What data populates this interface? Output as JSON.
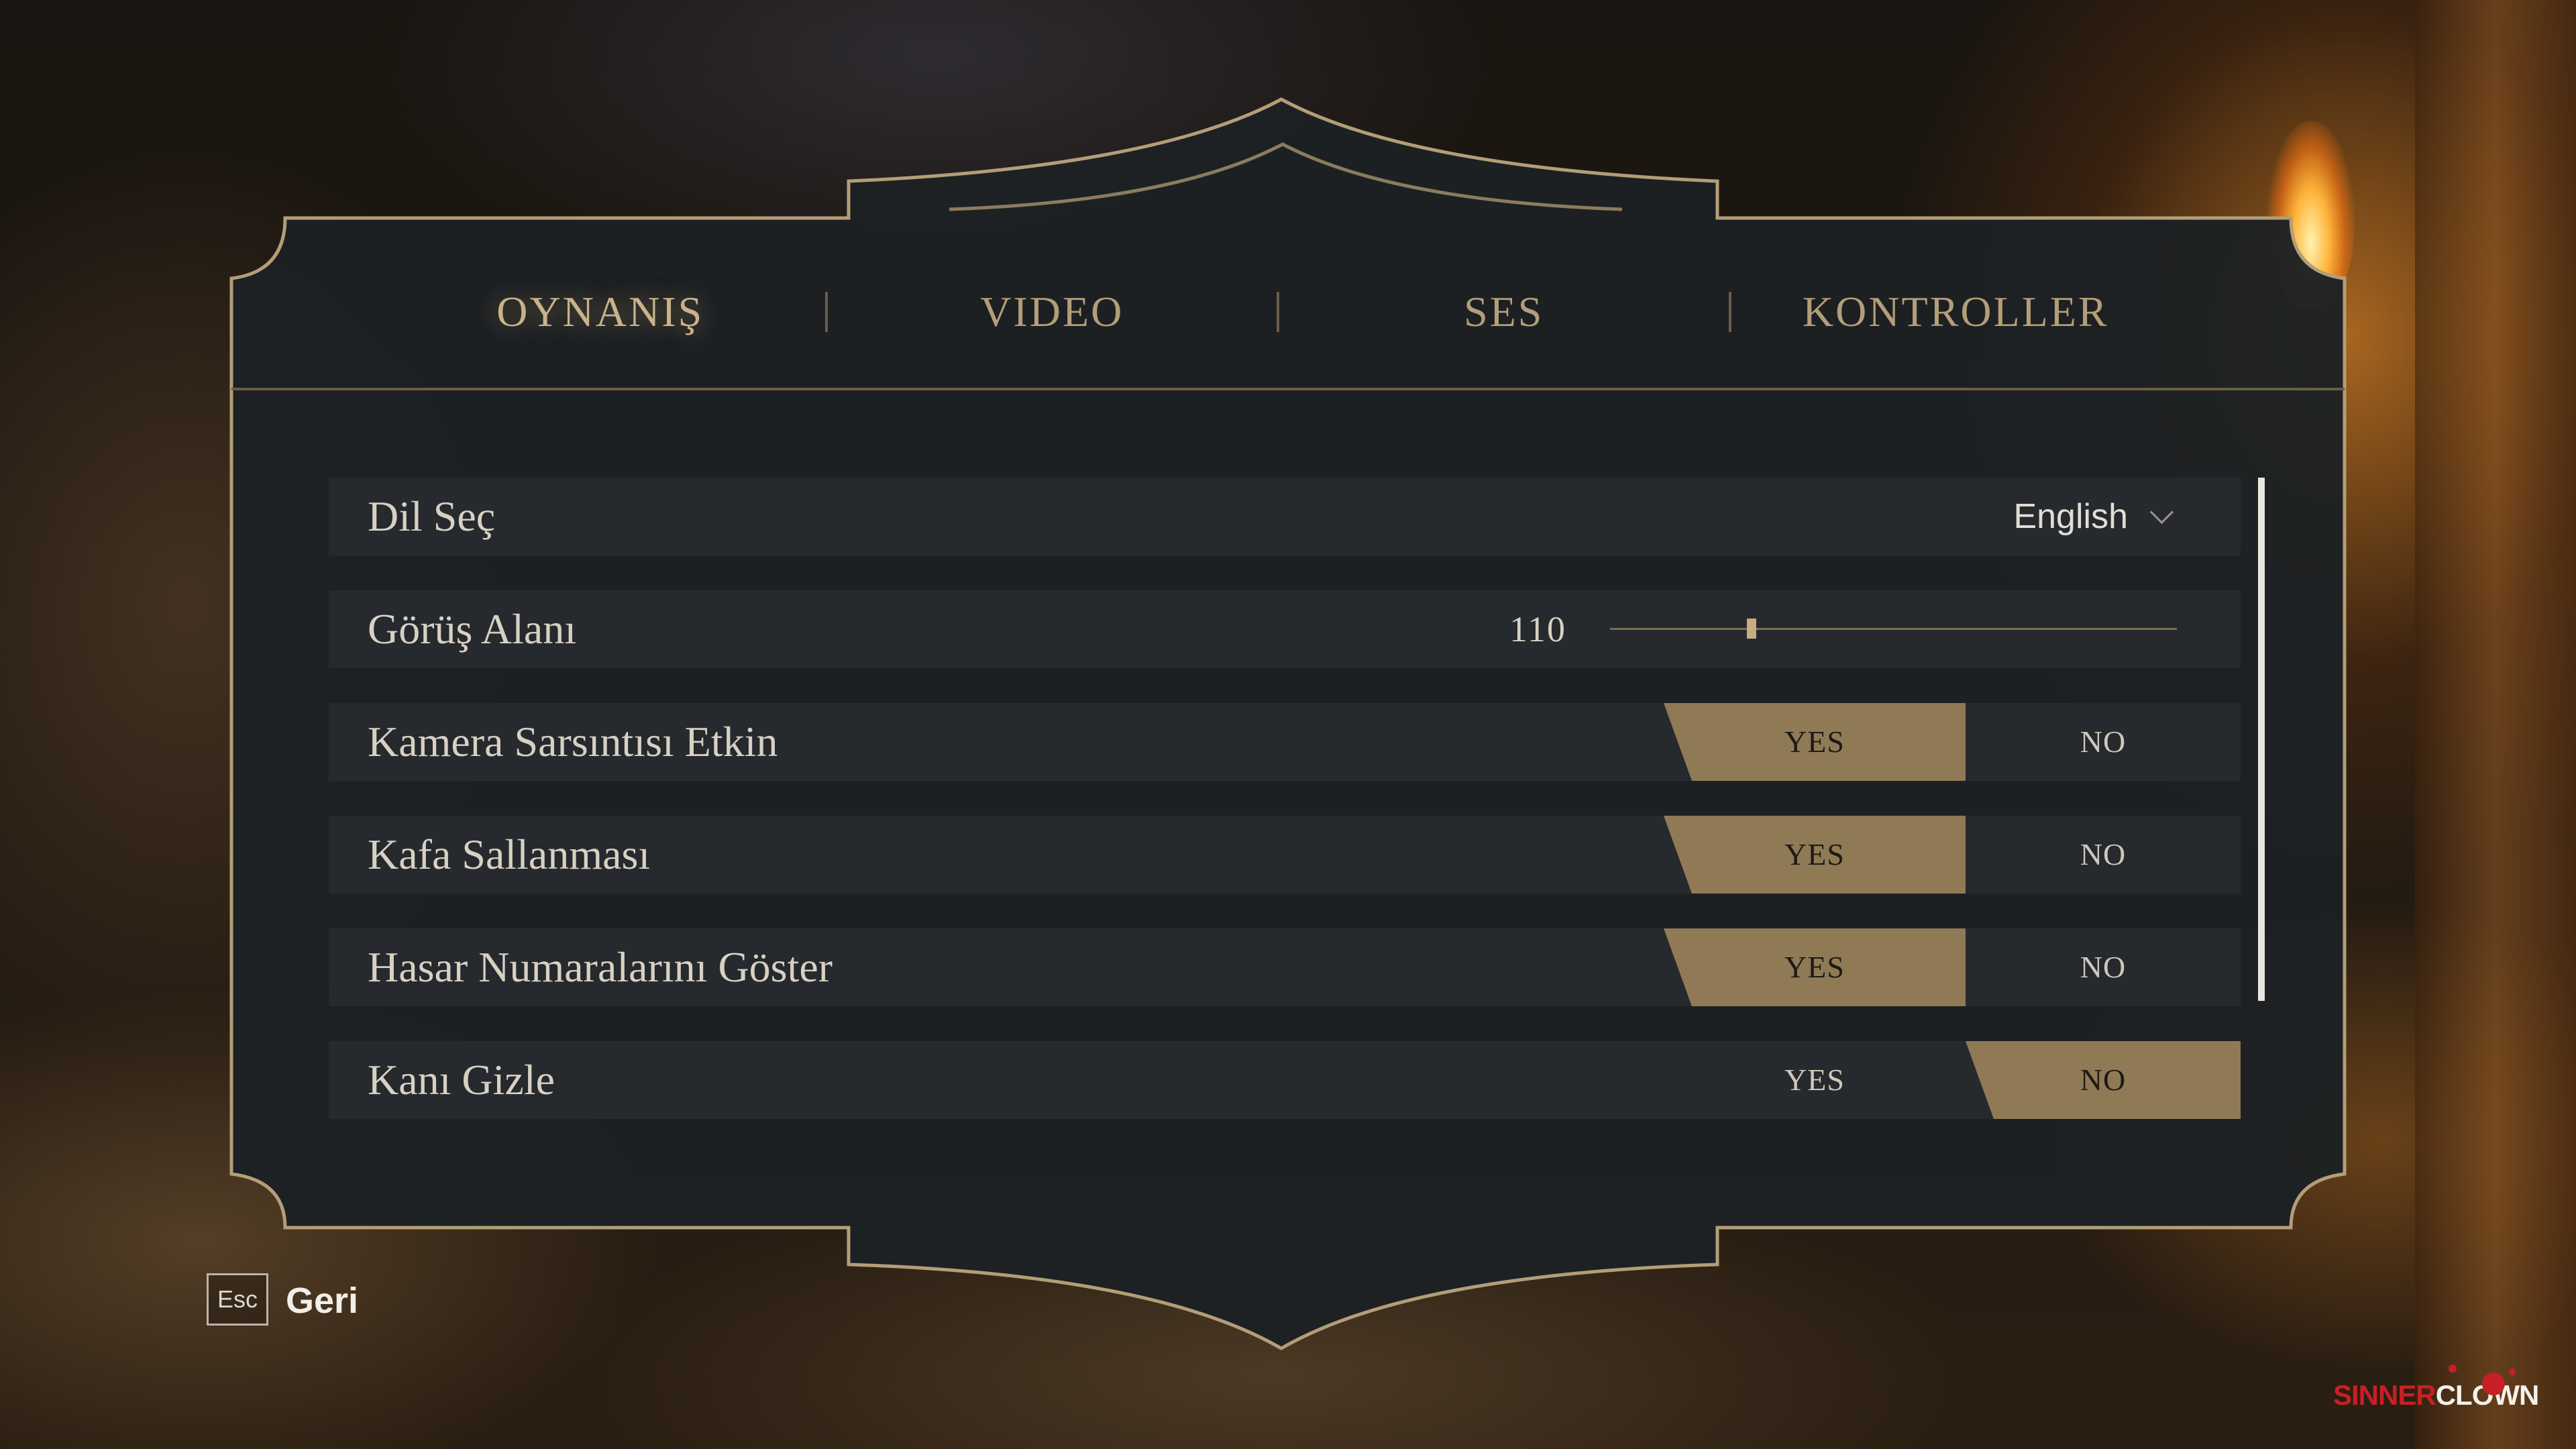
{
  "tabs": [
    {
      "label": "OYNANIŞ",
      "active": true
    },
    {
      "label": "VIDEO",
      "active": false
    },
    {
      "label": "SES",
      "active": false
    },
    {
      "label": "KONTROLLER",
      "active": false
    }
  ],
  "settings": {
    "language": {
      "label": "Dil Seç",
      "value": "English"
    },
    "fov": {
      "label": "Görüş Alanı",
      "value": "110",
      "slider_fraction": 0.25
    },
    "camera_shake": {
      "label": "Kamera Sarsıntısı Etkin",
      "yes": "YES",
      "no": "NO",
      "selected": "YES"
    },
    "head_bob": {
      "label": "Kafa Sallanması",
      "yes": "YES",
      "no": "NO",
      "selected": "YES"
    },
    "damage_numbers": {
      "label": "Hasar Numaralarını Göster",
      "yes": "YES",
      "no": "NO",
      "selected": "YES"
    },
    "hide_blood": {
      "label": "Kanı Gizle",
      "yes": "YES",
      "no": "NO",
      "selected": "NO"
    }
  },
  "footer": {
    "key": "Esc",
    "label": "Geri"
  },
  "logo": {
    "part1": "SINNER",
    "part2": "CLOWN"
  },
  "colors": {
    "accent": "#8f7a55",
    "panel": "#1d2124",
    "row": "#262a2e",
    "border": "#b39e78"
  }
}
